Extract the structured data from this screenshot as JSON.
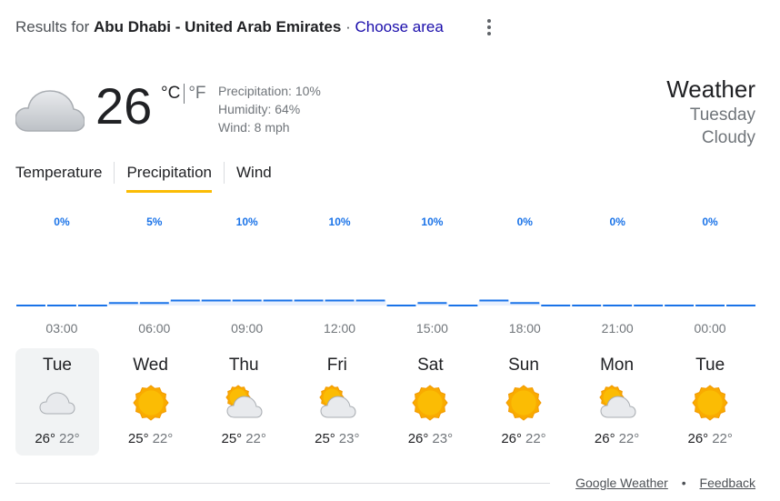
{
  "header": {
    "results_prefix": "Results for",
    "location": "Abu Dhabi - United Arab Emirates",
    "separator": "·",
    "choose_area": "Choose area"
  },
  "current": {
    "temperature": "26",
    "unit_c": "°C",
    "unit_f": "°F",
    "icon": "cloudy-icon",
    "precipitation": "Precipitation: 10%",
    "humidity": "Humidity: 64%",
    "wind": "Wind: 8 mph"
  },
  "right": {
    "title": "Weather",
    "day": "Tuesday",
    "condition": "Cloudy"
  },
  "tabs": [
    {
      "label": "Temperature",
      "active": false
    },
    {
      "label": "Precipitation",
      "active": true
    },
    {
      "label": "Wind",
      "active": false
    }
  ],
  "chart_data": {
    "type": "area",
    "title": "",
    "xlabel": "",
    "ylabel": "",
    "ylim": [
      0,
      100
    ],
    "hours": [
      "03:00",
      "06:00",
      "09:00",
      "12:00",
      "15:00",
      "18:00",
      "21:00",
      "00:00"
    ],
    "labels": [
      "0%",
      "5%",
      "10%",
      "10%",
      "10%",
      "0%",
      "0%",
      "0%"
    ],
    "series": [
      {
        "values": [
          0,
          0,
          0,
          5,
          5,
          10,
          10,
          10,
          10,
          10,
          10,
          10,
          0,
          5,
          0,
          10,
          5,
          0,
          0,
          0,
          0,
          0,
          0,
          0
        ]
      }
    ],
    "label_color": "#1a73e8",
    "line_color": "#1a73e8",
    "fill_color": "#e8f0fe"
  },
  "forecast": [
    {
      "day": "Tue",
      "icon": "cloudy-icon",
      "hi": "26°",
      "lo": "22°",
      "selected": true
    },
    {
      "day": "Wed",
      "icon": "sunny-icon",
      "hi": "25°",
      "lo": "22°",
      "selected": false
    },
    {
      "day": "Thu",
      "icon": "partly-cloudy-icon",
      "hi": "25°",
      "lo": "22°",
      "selected": false
    },
    {
      "day": "Fri",
      "icon": "partly-cloudy-icon",
      "hi": "25°",
      "lo": "23°",
      "selected": false
    },
    {
      "day": "Sat",
      "icon": "sunny-icon",
      "hi": "26°",
      "lo": "23°",
      "selected": false
    },
    {
      "day": "Sun",
      "icon": "sunny-icon",
      "hi": "26°",
      "lo": "22°",
      "selected": false
    },
    {
      "day": "Mon",
      "icon": "partly-cloudy-icon",
      "hi": "26°",
      "lo": "22°",
      "selected": false
    },
    {
      "day": "Tue",
      "icon": "sunny-icon",
      "hi": "26°",
      "lo": "22°",
      "selected": false
    }
  ],
  "footer": {
    "google_weather": "Google Weather",
    "dot": "•",
    "feedback": "Feedback"
  }
}
